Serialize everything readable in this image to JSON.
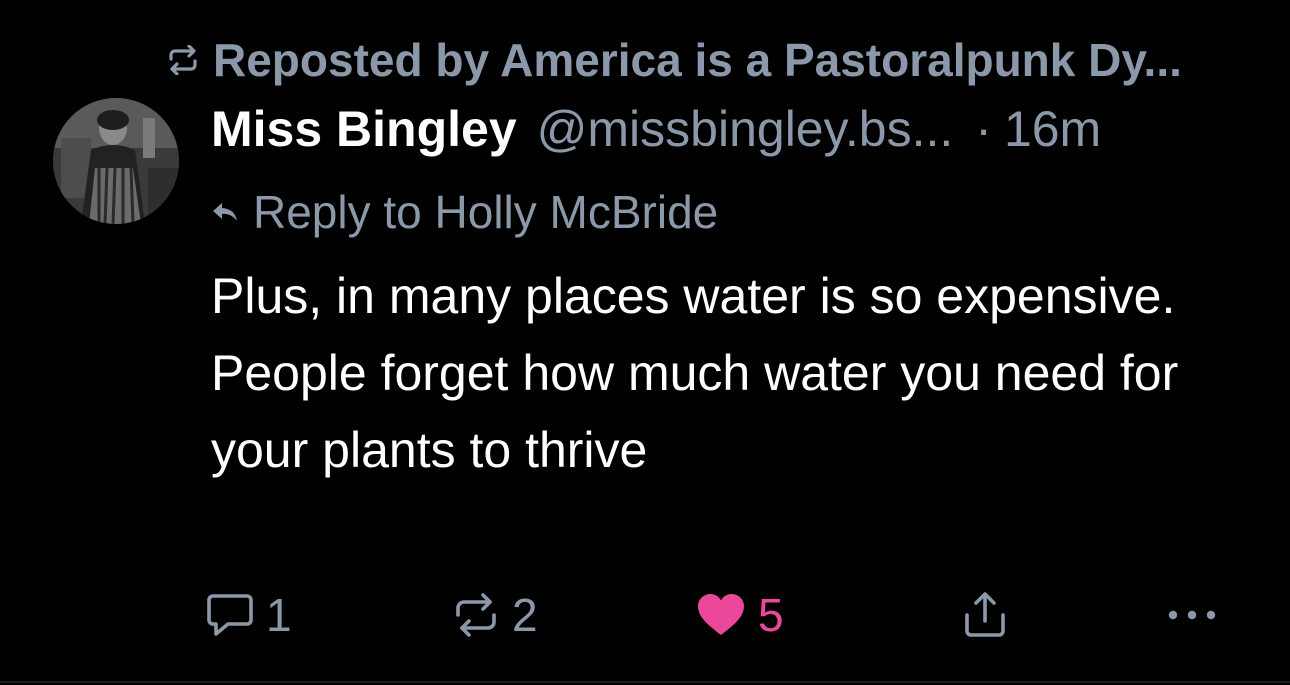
{
  "repost": {
    "icon": "repost-icon",
    "text": "Reposted by America is a Pastoralpunk Dy..."
  },
  "author": {
    "name": "Miss Bingley",
    "handle": "@missbingley.bs...",
    "separator": "·",
    "time": "16m",
    "avatar": "avatar-photo"
  },
  "reply_to": {
    "icon": "reply-arrow-icon",
    "text": "Reply to Holly McBride"
  },
  "post": {
    "text": "Plus, in many places water is so expensive. People forget how much water you need for your plants to thrive"
  },
  "actions": {
    "reply": {
      "icon": "comment-icon",
      "count": "1"
    },
    "repost": {
      "icon": "repost-icon",
      "count": "2"
    },
    "like": {
      "icon": "heart-icon",
      "count": "5",
      "active": true
    },
    "share": {
      "icon": "share-icon"
    },
    "more": {
      "icon": "more-icon"
    }
  },
  "colors": {
    "background": "#000000",
    "muted": "#8b98a9",
    "text": "#ffffff",
    "like": "#ec4899"
  }
}
